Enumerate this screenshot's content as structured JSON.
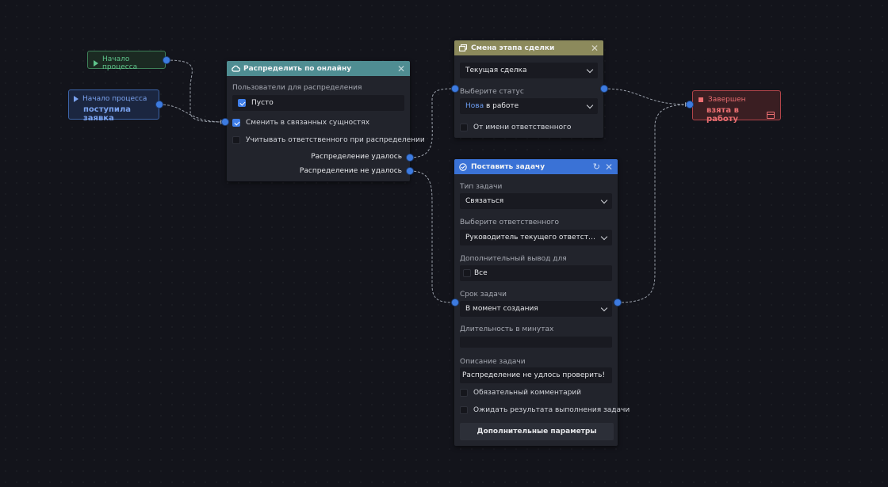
{
  "colors": {
    "canvas": "#13141b",
    "wire": "#9aa0aa",
    "port": "#3d7be0",
    "header_distribute": "#4f8d92",
    "header_stage": "#8c8a5c",
    "header_task": "#3a72d6",
    "start_green": "#5fc48b",
    "start_blue": "#7aa2ee",
    "end_red": "#ec6f72"
  },
  "start_node_1": {
    "label": "Начало процесса"
  },
  "start_node_2": {
    "label": "Начало процесса",
    "subtitle": "поступила заявка"
  },
  "end_node": {
    "label": "Завершен",
    "subtitle": "взята в работу"
  },
  "distribute_panel": {
    "title": "Распределить по онлайну",
    "users_label": "Пользователи для распределения",
    "users_value": "Пусто",
    "option_change_related": "Сменить в связанных сущностях",
    "option_change_related_checked": true,
    "option_consider_responsible": "Учитывать ответственного при распределении",
    "option_consider_responsible_checked": false,
    "output_success": "Распределение удалось",
    "output_fail": "Распределение не удалось"
  },
  "stage_panel": {
    "title": "Смена этапа сделки",
    "deal_value": "Текущая сделка",
    "status_label": "Выберите статус",
    "status_prefix": "Нова",
    "status_suffix": " в работе",
    "on_behalf": "От имени ответственного",
    "on_behalf_checked": false
  },
  "task_panel": {
    "title": "Поставить задачу",
    "type_label": "Тип задачи",
    "type_value": "Связаться",
    "responsible_label": "Выберите ответственного",
    "responsible_value": "Руководитель текущего ответственн...",
    "extra_output_label": "Дополнительный вывод для",
    "extra_output_value": "Все",
    "deadline_label": "Срок задачи",
    "deadline_value": "В момент создания",
    "duration_label": "Длительность в минутах",
    "duration_value": "",
    "description_label": "Описание задачи",
    "description_value": "Распределение не удлось проверить!",
    "required_comment": "Обязательный комментарий",
    "required_comment_checked": false,
    "await_result": "Ожидать результата выполнения задачи",
    "await_result_checked": false,
    "more_params_button": "Дополнительные параметры"
  }
}
